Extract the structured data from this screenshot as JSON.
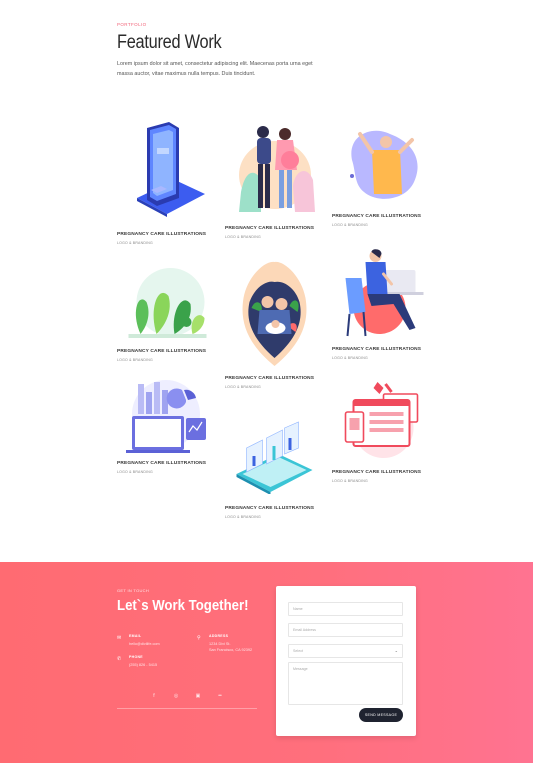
{
  "header": {
    "eyebrow": "PORTFOLIO",
    "title": "Featured Work",
    "intro": "Lorem ipsum dolor sit amet, consectetur adipiscing elit. Maecenas porta urna eget massa auctor, vitae maximus nulla tempus. Duis tincidunt."
  },
  "portfolio": {
    "items": [
      {
        "title": "PREGNANCY CARE ILLUSTRATIONS",
        "subtitle": "LOGO & BRANDING",
        "art": "phone-payment-illustration"
      },
      {
        "title": "PREGNANCY CARE ILLUSTRATIONS",
        "subtitle": "LOGO & BRANDING",
        "art": "couple-illustration"
      },
      {
        "title": "PREGNANCY CARE ILLUSTRATIONS",
        "subtitle": "LOGO & BRANDING",
        "art": "stretching-person-illustration"
      },
      {
        "title": "PREGNANCY CARE ILLUSTRATIONS",
        "subtitle": "LOGO & BRANDING",
        "art": "plants-illustration"
      },
      {
        "title": "PREGNANCY CARE ILLUSTRATIONS",
        "subtitle": "LOGO & BRANDING",
        "art": "family-heart-illustration"
      },
      {
        "title": "PREGNANCY CARE ILLUSTRATIONS",
        "subtitle": "LOGO & BRANDING",
        "art": "person-at-desk-illustration"
      },
      {
        "title": "PREGNANCY CARE ILLUSTRATIONS",
        "subtitle": "LOGO & BRANDING",
        "art": "chart-monitor-illustration"
      },
      {
        "title": "PREGNANCY CARE ILLUSTRATIONS",
        "subtitle": "LOGO & BRANDING",
        "art": "isometric-dashboard-illustration"
      },
      {
        "title": "PREGNANCY CARE ILLUSTRATIONS",
        "subtitle": "LOGO & BRANDING",
        "art": "browser-windows-illustration"
      }
    ]
  },
  "contact": {
    "eyebrow": "GET IN TOUCH",
    "title": "Let`s Work Together!",
    "email": {
      "label": "EMAIL",
      "value": "hello@divilife.com",
      "icon": "envelope-icon"
    },
    "address": {
      "label": "ADDRESS",
      "line1": "1234 Divi St.",
      "line2": "San Francisco, CA 92392",
      "icon": "map-pin-icon"
    },
    "phone": {
      "label": "PHONE",
      "value": "(255) 826 - 5415",
      "icon": "phone-icon"
    },
    "social": [
      {
        "name": "facebook",
        "glyph": "f"
      },
      {
        "name": "dribbble",
        "glyph": "◎"
      },
      {
        "name": "instagram",
        "glyph": "▣"
      },
      {
        "name": "flickr",
        "glyph": "••"
      }
    ]
  },
  "form": {
    "name_placeholder": "Name",
    "email_placeholder": "Email Address",
    "select_value": "Select",
    "message_placeholder": "Message",
    "send_label": "SEND MESSAGE"
  },
  "colors": {
    "accent": "#f2657a",
    "gradient_start": "#ff6b72",
    "gradient_end": "#ff7391",
    "button": "#1f2330"
  }
}
